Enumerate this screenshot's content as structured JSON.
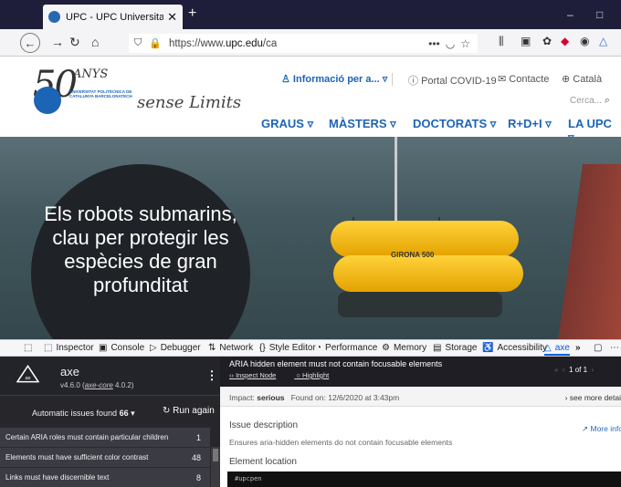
{
  "browser": {
    "tab_title": "UPC - UPC Universitat Politècnica",
    "new_tab": "+",
    "window_minimize": "–",
    "window_restore": "□",
    "url_prefix": "https://www.",
    "url_domain": "upc.edu",
    "url_path": "/ca",
    "page_actions": "•••"
  },
  "site": {
    "logo_big": "50",
    "logo_anys": "ANYS",
    "logo_university": "UNIVERSITAT POLITÈCNICA DE CATALUNYA BARCELONATECH",
    "logo_slogan": "sense Limits",
    "info_link": "Informació per a...",
    "covid_link": "Portal COVID-19",
    "contact_link": "Contacte",
    "language": "Català",
    "search_placeholder": "Cerca...",
    "nav": [
      "GRAUS",
      "MÀSTERS",
      "DOCTORATS",
      "R+D+I",
      "LA UPC"
    ]
  },
  "hero": {
    "headline": "Els robots submarins, clau per protegir les espècies de gran profunditat",
    "vehicle_label": "GIRONA 500"
  },
  "devtools": {
    "tabs": [
      "Inspector",
      "Console",
      "Debugger",
      "Network",
      "Style Editor",
      "Performance",
      "Memory",
      "Storage",
      "Accessibility",
      "axe"
    ],
    "overflow": "»"
  },
  "axe": {
    "name": "axe",
    "version": "v4.6.0",
    "core_link": "axe-core",
    "core_version": "4.0.2",
    "issues_label": "Automatic issues found",
    "issues_count": "66",
    "run_again": "Run again",
    "issues": [
      {
        "label": "Certain ARIA roles must contain particular children",
        "count": "1"
      },
      {
        "label": "Elements must have sufficient color contrast",
        "count": "48"
      },
      {
        "label": "Links must have discernible text",
        "count": "8"
      }
    ],
    "detail": {
      "title": "ARIA hidden element must not contain focusable elements",
      "inspect_node": "Inspect Node",
      "highlight": "Highlight",
      "pager": "1 of 1",
      "impact_label": "Impact:",
      "impact_value": "serious",
      "found_on": "Found on: 12/6/2020 at 3:43pm",
      "see_more": "see more detai",
      "desc_title": "Issue description",
      "desc_text": "Ensures aria-hidden elements do not contain focusable elements",
      "more_info": "More info",
      "location_title": "Element location",
      "code": "#upcpen"
    }
  },
  "colors": {
    "upc_blue": "#1c64b6",
    "axe_dark": "#26262b",
    "devtools_active": "#0060df"
  }
}
